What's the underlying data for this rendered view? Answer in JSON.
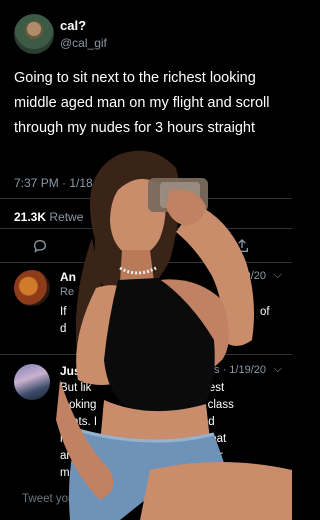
{
  "tweet": {
    "display_name": "cal?",
    "handle": "@cal_gif",
    "text": "Going to sit next to the richest looking middle aged man on my flight and scroll through my nudes for 3 hours straight",
    "time": "7:37 PM · 1/18",
    "retweet_count": "21.3K",
    "retweet_label": "Retwe"
  },
  "replies": [
    {
      "name": "An",
      "date": "1/19/20",
      "sub": "Re",
      "lines": [
        "If",
        "d"
      ],
      "tail": "of"
    },
    {
      "name": "Just",
      "date": "es · 1/19/20",
      "lines": [
        "But lik                    be the richest",
        "looking                    hem first class",
        "seats. I                   ever spend",
        "hundr                      a bigger seat",
        "and a                      ot. Play your",
        "mor"
      ]
    }
  ],
  "composer": {
    "placeholder": "Tweet your"
  },
  "icons": {
    "more": "chevron-down-icon",
    "reply": "reply-icon",
    "share": "share-icon"
  },
  "colors": {
    "background": "#000000",
    "text": "#ffffff",
    "muted": "#8b98a5"
  }
}
